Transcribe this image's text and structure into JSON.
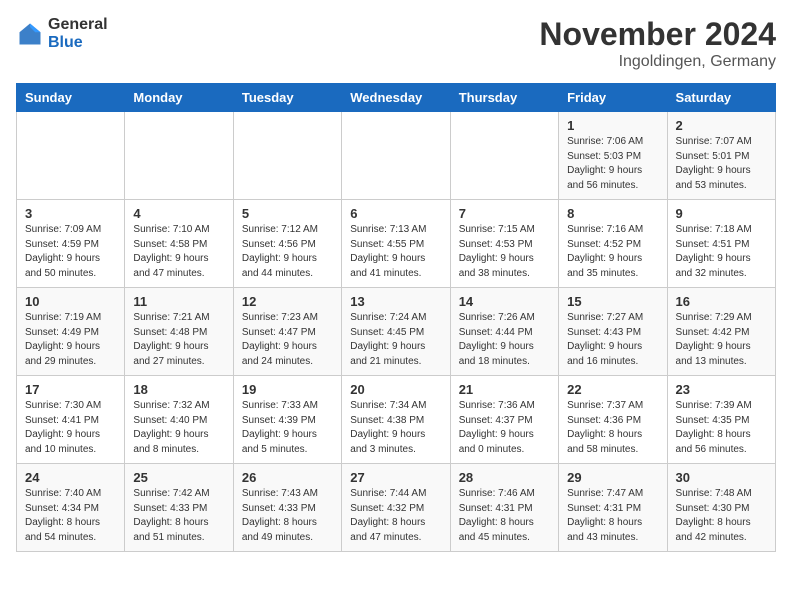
{
  "logo": {
    "general": "General",
    "blue": "Blue"
  },
  "title": "November 2024",
  "location": "Ingoldingen, Germany",
  "weekdays": [
    "Sunday",
    "Monday",
    "Tuesday",
    "Wednesday",
    "Thursday",
    "Friday",
    "Saturday"
  ],
  "weeks": [
    [
      {
        "day": "",
        "info": ""
      },
      {
        "day": "",
        "info": ""
      },
      {
        "day": "",
        "info": ""
      },
      {
        "day": "",
        "info": ""
      },
      {
        "day": "",
        "info": ""
      },
      {
        "day": "1",
        "info": "Sunrise: 7:06 AM\nSunset: 5:03 PM\nDaylight: 9 hours\nand 56 minutes."
      },
      {
        "day": "2",
        "info": "Sunrise: 7:07 AM\nSunset: 5:01 PM\nDaylight: 9 hours\nand 53 minutes."
      }
    ],
    [
      {
        "day": "3",
        "info": "Sunrise: 7:09 AM\nSunset: 4:59 PM\nDaylight: 9 hours\nand 50 minutes."
      },
      {
        "day": "4",
        "info": "Sunrise: 7:10 AM\nSunset: 4:58 PM\nDaylight: 9 hours\nand 47 minutes."
      },
      {
        "day": "5",
        "info": "Sunrise: 7:12 AM\nSunset: 4:56 PM\nDaylight: 9 hours\nand 44 minutes."
      },
      {
        "day": "6",
        "info": "Sunrise: 7:13 AM\nSunset: 4:55 PM\nDaylight: 9 hours\nand 41 minutes."
      },
      {
        "day": "7",
        "info": "Sunrise: 7:15 AM\nSunset: 4:53 PM\nDaylight: 9 hours\nand 38 minutes."
      },
      {
        "day": "8",
        "info": "Sunrise: 7:16 AM\nSunset: 4:52 PM\nDaylight: 9 hours\nand 35 minutes."
      },
      {
        "day": "9",
        "info": "Sunrise: 7:18 AM\nSunset: 4:51 PM\nDaylight: 9 hours\nand 32 minutes."
      }
    ],
    [
      {
        "day": "10",
        "info": "Sunrise: 7:19 AM\nSunset: 4:49 PM\nDaylight: 9 hours\nand 29 minutes."
      },
      {
        "day": "11",
        "info": "Sunrise: 7:21 AM\nSunset: 4:48 PM\nDaylight: 9 hours\nand 27 minutes."
      },
      {
        "day": "12",
        "info": "Sunrise: 7:23 AM\nSunset: 4:47 PM\nDaylight: 9 hours\nand 24 minutes."
      },
      {
        "day": "13",
        "info": "Sunrise: 7:24 AM\nSunset: 4:45 PM\nDaylight: 9 hours\nand 21 minutes."
      },
      {
        "day": "14",
        "info": "Sunrise: 7:26 AM\nSunset: 4:44 PM\nDaylight: 9 hours\nand 18 minutes."
      },
      {
        "day": "15",
        "info": "Sunrise: 7:27 AM\nSunset: 4:43 PM\nDaylight: 9 hours\nand 16 minutes."
      },
      {
        "day": "16",
        "info": "Sunrise: 7:29 AM\nSunset: 4:42 PM\nDaylight: 9 hours\nand 13 minutes."
      }
    ],
    [
      {
        "day": "17",
        "info": "Sunrise: 7:30 AM\nSunset: 4:41 PM\nDaylight: 9 hours\nand 10 minutes."
      },
      {
        "day": "18",
        "info": "Sunrise: 7:32 AM\nSunset: 4:40 PM\nDaylight: 9 hours\nand 8 minutes."
      },
      {
        "day": "19",
        "info": "Sunrise: 7:33 AM\nSunset: 4:39 PM\nDaylight: 9 hours\nand 5 minutes."
      },
      {
        "day": "20",
        "info": "Sunrise: 7:34 AM\nSunset: 4:38 PM\nDaylight: 9 hours\nand 3 minutes."
      },
      {
        "day": "21",
        "info": "Sunrise: 7:36 AM\nSunset: 4:37 PM\nDaylight: 9 hours\nand 0 minutes."
      },
      {
        "day": "22",
        "info": "Sunrise: 7:37 AM\nSunset: 4:36 PM\nDaylight: 8 hours\nand 58 minutes."
      },
      {
        "day": "23",
        "info": "Sunrise: 7:39 AM\nSunset: 4:35 PM\nDaylight: 8 hours\nand 56 minutes."
      }
    ],
    [
      {
        "day": "24",
        "info": "Sunrise: 7:40 AM\nSunset: 4:34 PM\nDaylight: 8 hours\nand 54 minutes."
      },
      {
        "day": "25",
        "info": "Sunrise: 7:42 AM\nSunset: 4:33 PM\nDaylight: 8 hours\nand 51 minutes."
      },
      {
        "day": "26",
        "info": "Sunrise: 7:43 AM\nSunset: 4:33 PM\nDaylight: 8 hours\nand 49 minutes."
      },
      {
        "day": "27",
        "info": "Sunrise: 7:44 AM\nSunset: 4:32 PM\nDaylight: 8 hours\nand 47 minutes."
      },
      {
        "day": "28",
        "info": "Sunrise: 7:46 AM\nSunset: 4:31 PM\nDaylight: 8 hours\nand 45 minutes."
      },
      {
        "day": "29",
        "info": "Sunrise: 7:47 AM\nSunset: 4:31 PM\nDaylight: 8 hours\nand 43 minutes."
      },
      {
        "day": "30",
        "info": "Sunrise: 7:48 AM\nSunset: 4:30 PM\nDaylight: 8 hours\nand 42 minutes."
      }
    ]
  ]
}
